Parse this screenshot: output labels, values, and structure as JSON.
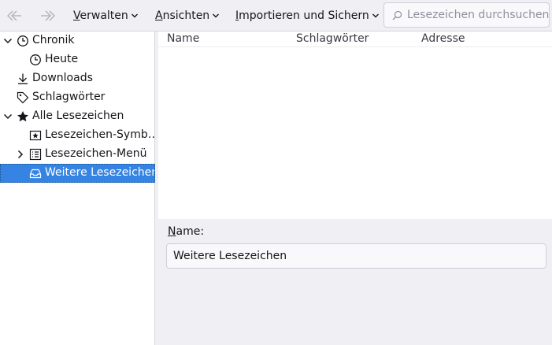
{
  "toolbar": {
    "back_icon": "back-arrow-icon",
    "forward_icon": "forward-arrow-icon",
    "menus": [
      {
        "first": "V",
        "rest": "erwalten"
      },
      {
        "first": "A",
        "rest": "nsichten"
      },
      {
        "first": "I",
        "rest": "mportieren und Sichern"
      }
    ],
    "search": {
      "placeholder": "Lesezeichen durchsuchen",
      "value": ""
    }
  },
  "sidebar": {
    "items": [
      {
        "label": "Chronik",
        "icon": "clock-icon",
        "expanded": true
      },
      {
        "label": "Heute",
        "icon": "clock-icon"
      },
      {
        "label": "Downloads",
        "icon": "download-icon"
      },
      {
        "label": "Schlagwörter",
        "icon": "tag-icon"
      },
      {
        "label": "Alle Lesezeichen",
        "icon": "star-icon",
        "expanded": true
      },
      {
        "label": "Lesezeichen-Symb…",
        "icon": "bookmarks-toolbar-icon"
      },
      {
        "label": "Lesezeichen-Menü",
        "icon": "bookmarks-menu-icon",
        "expanded": false
      },
      {
        "label": "Weitere Lesezeichen",
        "icon": "inbox-folder-icon",
        "selected": true
      }
    ]
  },
  "list": {
    "columns": [
      "Name",
      "Schlagwörter",
      "Adresse"
    ]
  },
  "details": {
    "name_label_first": "N",
    "name_label_rest": "ame:",
    "name_value": "Weitere Lesezeichen"
  },
  "colors": {
    "selection": "#3584e4",
    "window_bg": "#f0f0f4"
  }
}
